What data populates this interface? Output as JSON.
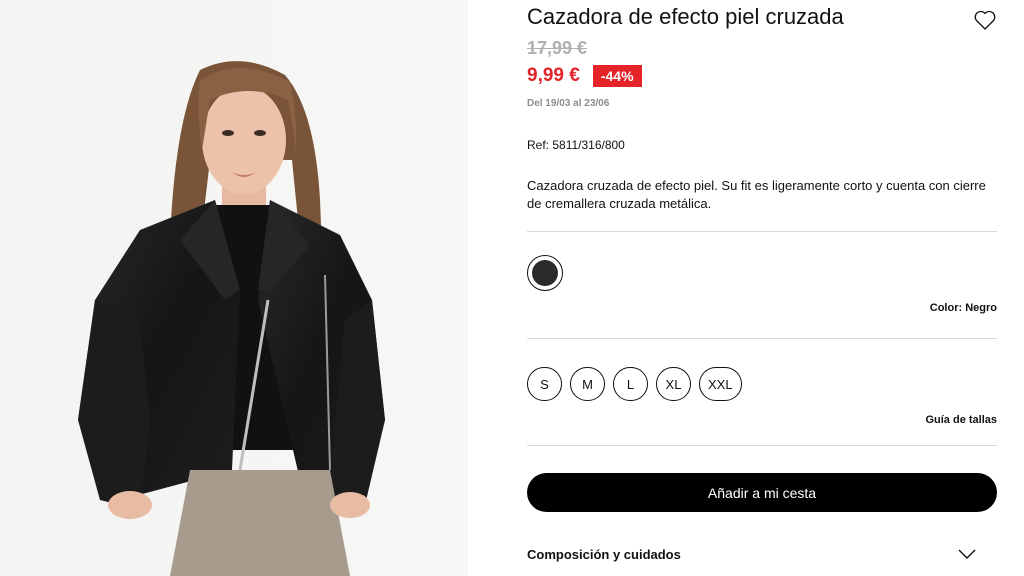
{
  "product": {
    "title": "Cazadora de efecto piel cruzada",
    "price_old": "17,99 €",
    "price_new": "9,99 €",
    "discount": "-44%",
    "promo_dates": "Del 19/03 al 23/06",
    "reference": "Ref: 5811/316/800",
    "description": "Cazadora cruzada de efecto piel. Su fit es ligeramente corto y cuenta con cierre de cremallera cruzada metálica."
  },
  "image": {
    "description_icon": "product-photo"
  },
  "color": {
    "label": "Color:",
    "selected": "Negro",
    "swatch_hex": "#2b2b2b"
  },
  "sizes": [
    "S",
    "M",
    "L",
    "XL",
    "XXL"
  ],
  "size_guide_label": "Guía de tallas",
  "add_to_cart_label": "Añadir a mi cesta",
  "accordion": {
    "label": "Composición y cuidados"
  },
  "icons": {
    "wishlist": "heart-icon",
    "accordion": "chevron-down-icon"
  },
  "colors": {
    "sale_red": "#e5242a",
    "button_black": "#000000",
    "divider": "#d9d9d9"
  }
}
